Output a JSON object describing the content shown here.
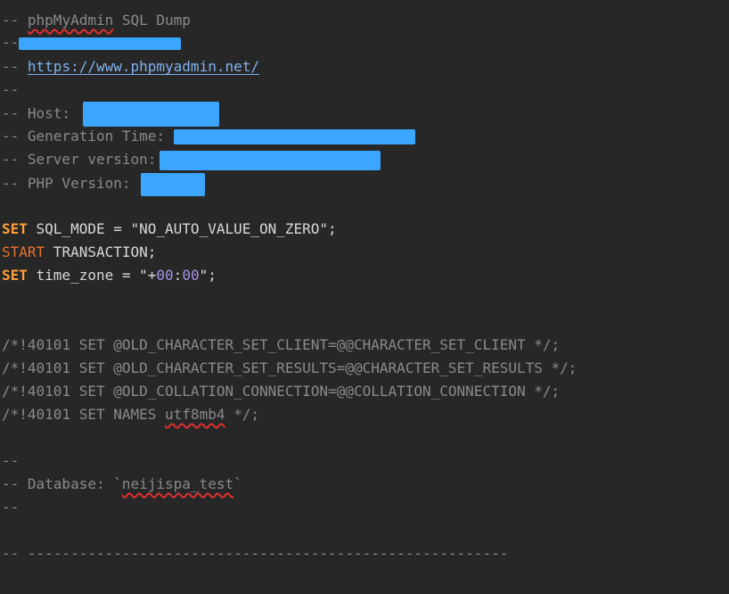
{
  "dump_header": {
    "prefix": "-- ",
    "app_name": "phpMyAdmin",
    "title_rest": " SQL Dump",
    "line2": "--",
    "url_prefix": "-- ",
    "url": "https://www.phpmyadmin.net/",
    "line4": "--",
    "host_label": "-- Host: ",
    "generation_label": "-- Generation Time: ",
    "server_label": "-- Server version:",
    "php_label": "-- PHP Version: "
  },
  "statements": {
    "set_kw": "SET",
    "sql_mode_rest": " SQL_MODE = \"NO_AUTO_VALUE_ON_ZERO\";",
    "start_kw": "START",
    "transaction_rest": " TRANSACTION;",
    "set_kw2": "SET",
    "time_zone_a": " time_zone = \"+",
    "time_zone_h": "00",
    "time_zone_colon": ":",
    "time_zone_m": "00",
    "time_zone_end": "\";"
  },
  "charset_directives": {
    "line1": "/*!40101 SET @OLD_CHARACTER_SET_CLIENT=@@CHARACTER_SET_CLIENT */;",
    "line2": "/*!40101 SET @OLD_CHARACTER_SET_RESULTS=@@CHARACTER_SET_RESULTS */;",
    "line3": "/*!40101 SET @OLD_COLLATION_CONNECTION=@@COLLATION_CONNECTION */;",
    "names_prefix": "/*!40101 SET NAMES ",
    "names_value": "utf8mb4",
    "names_suffix": " */;"
  },
  "database_section": {
    "line1": "--",
    "db_prefix": "-- Database: `",
    "db_name": "neijispa_test",
    "db_suffix": "`",
    "line3": "--",
    "separator": "-- --------------------------------------------------------"
  },
  "colors": {
    "background": "#272727",
    "comment": "#8a8a8a",
    "keyword": "#ff9e3b",
    "redaction": "#3ba6ff",
    "link": "#7fb2f0",
    "number": "#a894e8"
  }
}
